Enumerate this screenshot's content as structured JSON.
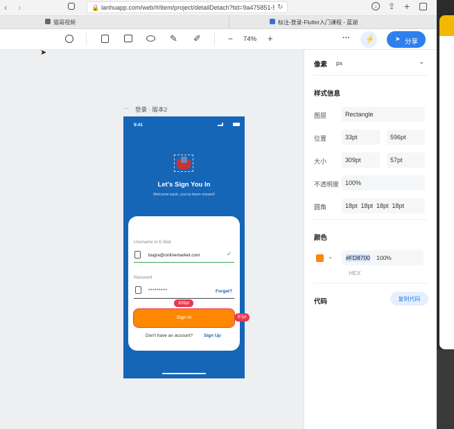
{
  "browser": {
    "url": "lanhuapp.com/web/#/item/project/detailDetach?tid=9a475851-5",
    "tab1": "猫哥视频",
    "tab2": "标注-登录-Flutter入门课程 - 蓝湖"
  },
  "toolbar": {
    "zoom": "74%",
    "minus": "−",
    "plus": "+",
    "more": "···",
    "share_label": "分享"
  },
  "artboard": {
    "title": "登录 · 版本2",
    "dots": "···"
  },
  "phone": {
    "time": "9:41",
    "heading": "Let's Sign You In",
    "subheading": "Welcome back, you've been missed!",
    "username_label": "Username or E-Mail",
    "username_value": "bugra@onlinemarket.com",
    "password_label": "Password",
    "password_value": "*********",
    "forgot": "Forget?",
    "signin": "Sign In",
    "no_account": "Don't have an account?",
    "signup": "Sign Up",
    "width_badge": "309pt",
    "height_badge": "57pt"
  },
  "panel": {
    "unit_label": "像素",
    "unit_value": "px",
    "style_title": "样式信息",
    "layer_label": "图层",
    "layer_value": "Rectangle",
    "pos_label": "位置",
    "pos_x": "33pt",
    "pos_y": "596pt",
    "size_label": "大小",
    "size_w": "309pt",
    "size_h": "57pt",
    "opacity_label": "不透明度",
    "opacity_value": "100%",
    "radius_label": "圆角",
    "radius_value": "18pt  18pt  18pt  18pt",
    "color_title": "颜色",
    "color_hex": "#FD8700",
    "color_opacity": "100%",
    "color_format": "HEX",
    "code_title": "代码",
    "copy_code": "复制代码"
  },
  "colors": {
    "accent": "#2f80ed",
    "phone_bg": "#1566b7",
    "button": "#fd8700",
    "badge": "#e8384f"
  }
}
